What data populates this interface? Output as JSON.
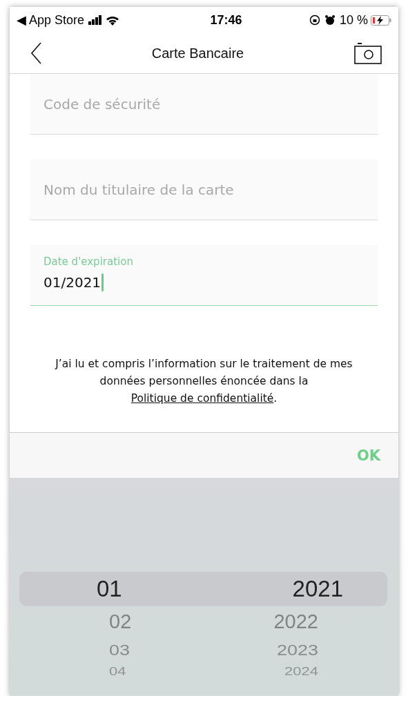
{
  "status_bar": {
    "back_label": "◀ App Store",
    "time": "17:46",
    "battery": "10 %"
  },
  "nav": {
    "title": "Carte Bancaire"
  },
  "fields": [
    {
      "placeholder": "Code de sécurité",
      "focused": false
    },
    {
      "placeholder": "Nom du titulaire de la carte",
      "focused": false
    },
    {
      "label": "Date d'expiration",
      "value": "01/2021",
      "focused": true
    }
  ],
  "consent": {
    "text": "J’ai lu et compris l’information sur le traitement de mes données personnelles énoncée dans la",
    "link": "Politique de confidentialité",
    "end": "."
  },
  "toolbar": {
    "done": "OK"
  },
  "picker": {
    "columns": [
      {
        "items": [
          {
            "label": "01",
            "selected": true
          },
          {
            "label": "02",
            "selected": false
          },
          {
            "label": "03",
            "selected": false
          },
          {
            "label": "04",
            "selected": false
          }
        ]
      },
      {
        "items": [
          {
            "label": "2021",
            "selected": true
          },
          {
            "label": "2022",
            "selected": false
          },
          {
            "label": "2023",
            "selected": false
          },
          {
            "label": "2024",
            "selected": false
          }
        ]
      }
    ]
  }
}
